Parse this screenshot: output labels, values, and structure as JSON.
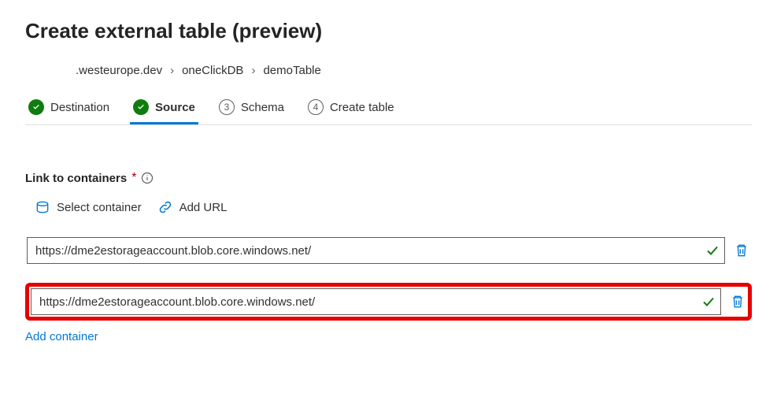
{
  "header": {
    "title": "Create external table (preview)"
  },
  "breadcrumb": {
    "items": [
      {
        "label": ".westeurope.dev"
      },
      {
        "label": "oneClickDB"
      },
      {
        "label": "demoTable"
      }
    ]
  },
  "steps": [
    {
      "label": "Destination",
      "state": "completed"
    },
    {
      "label": "Source",
      "state": "active"
    },
    {
      "label": "Schema",
      "state": "pending",
      "number": "3"
    },
    {
      "label": "Create table",
      "state": "pending",
      "number": "4"
    }
  ],
  "form": {
    "link_label": "Link to containers",
    "actions": {
      "select_container": "Select container",
      "add_url": "Add URL"
    },
    "containers": [
      {
        "value": "https://dme2estorageaccount.blob.core.windows.net/",
        "valid": true,
        "highlighted": false
      },
      {
        "value": "https://dme2estorageaccount.blob.core.windows.net/",
        "valid": true,
        "highlighted": true
      }
    ],
    "add_container_label": "Add container"
  },
  "colors": {
    "accent": "#0078d4",
    "success": "#107c10",
    "border": "#605e5c",
    "highlight": "#e60000"
  }
}
